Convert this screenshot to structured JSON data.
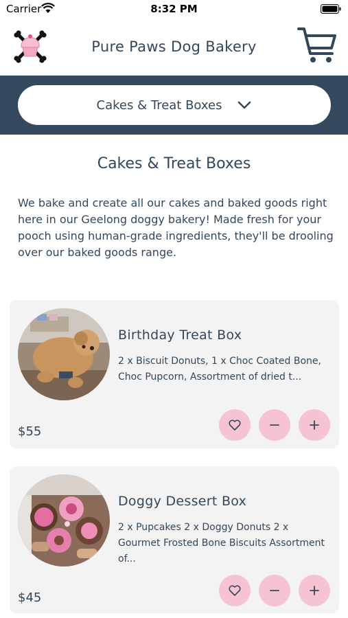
{
  "status_bar": {
    "carrier": "Carrier",
    "time": "8:32 PM"
  },
  "header": {
    "title": "Pure Paws Dog Bakery"
  },
  "category_select": {
    "selected": "Cakes & Treat Boxes"
  },
  "page": {
    "title": "Cakes & Treat Boxes",
    "intro": "We bake and create all our cakes and baked goods right here in our Geelong doggy bakery! Made fresh for your pooch using human-grade ingredients, they'll be drooling over our baked goods range."
  },
  "products": [
    {
      "name": "Birthday Treat Box",
      "description": "2 x Biscuit Donuts, 1 x Choc Coated Bone, Choc Pupcorn, Assortment of dried t...",
      "price": "$55"
    },
    {
      "name": "Doggy Dessert Box",
      "description": "2 x Pupcakes 2 x Doggy Donuts 2 x Gourmet Frosted Bone Biscuits Assortment of...",
      "price": "$45"
    }
  ],
  "colors": {
    "band": "#34495e",
    "text": "#33475b",
    "button": "#f6c3d3",
    "card": "#f3f3f3"
  },
  "icons": [
    "wifi-icon",
    "battery-icon",
    "cupcake-crossbones-logo-icon",
    "cart-icon",
    "chevron-down-icon",
    "heart-icon",
    "minus-icon",
    "plus-icon"
  ]
}
